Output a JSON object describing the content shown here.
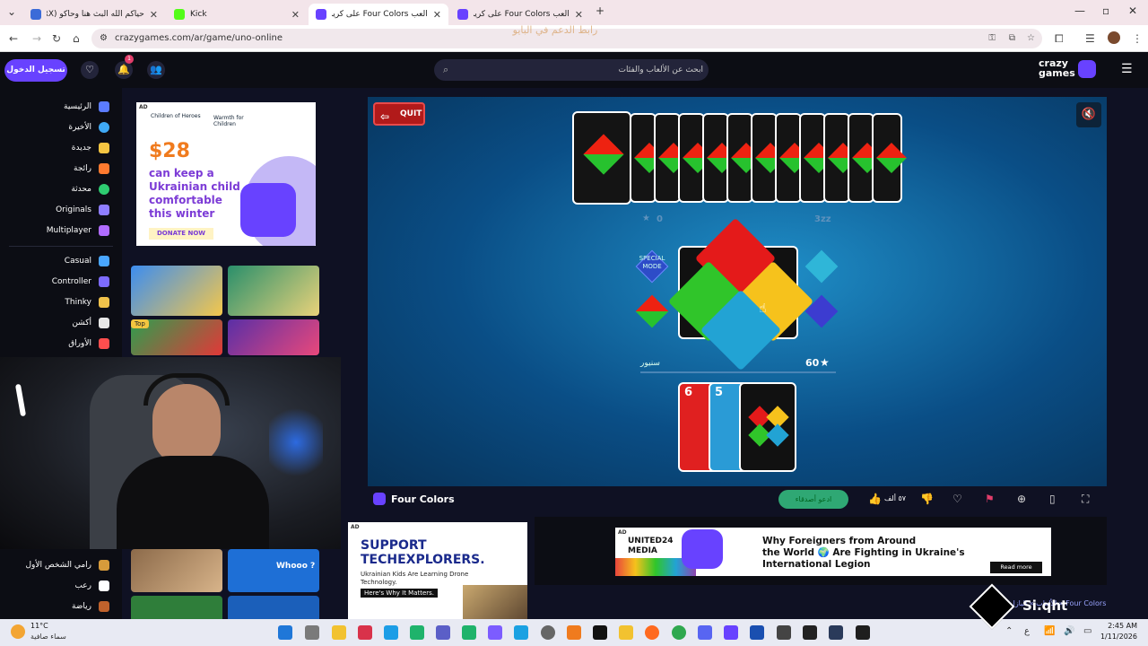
{
  "browser": {
    "tabs": [
      {
        "title": "حياكم الله البث هنا وحاكو (TWRX)",
        "fav": "#3b6bd8"
      },
      {
        "title": "Kick",
        "fav": "#53fc18"
      },
      {
        "title": "العب Four Colors على كريز...",
        "fav": "#6842ff"
      },
      {
        "title": "العب Four Colors على كريز...",
        "fav": "#6842ff"
      }
    ],
    "url": "crazygames.com/ar/game/uno-online",
    "watermark": "رابط الدعم في البايو"
  },
  "header": {
    "login_label": "تسجيل الدخول",
    "notif_count": "1",
    "search_placeholder": "ابحث عن الألعاب والفئات",
    "logo_line1": "crazy",
    "logo_line2": "games"
  },
  "sidebar": {
    "items": [
      {
        "label": "الرئيسية",
        "color": "#5b7cff"
      },
      {
        "label": "الأخيرة",
        "color": "#3fa9f5"
      },
      {
        "label": "جديدة",
        "color": "#f5c542"
      },
      {
        "label": "رائجة",
        "color": "#ff7a2f"
      },
      {
        "label": "محدثة",
        "color": "#2ecc71"
      },
      {
        "label": "Originals",
        "color": "#8e7dff"
      },
      {
        "label": "Multiplayer",
        "color": "#b06cff"
      },
      {
        "label": "Casual",
        "color": "#49a6ff"
      },
      {
        "label": "Controller",
        "color": "#7d6bff"
      },
      {
        "label": "Thinky",
        "color": "#f0c24b"
      },
      {
        "label": "أكشن",
        "color": "#e7e7e7"
      },
      {
        "label": "الأوراق",
        "color": "#ff4e4e"
      }
    ],
    "bottom_items": [
      {
        "label": "رامي الشخص الأول",
        "color": "#d79b3b"
      },
      {
        "label": "رعب",
        "color": "#ffffff"
      },
      {
        "label": "رياضة",
        "color": "#c0622c"
      }
    ]
  },
  "left_ad": {
    "tag": "AD",
    "org1": "Children of Heroes",
    "org2": "Warmth for Children",
    "amount": "$28",
    "line1": "can keep a",
    "line2": "Ukrainian child",
    "line3": "comfortable",
    "line4": "this winter",
    "cta": "DONATE NOW"
  },
  "thumbs": {
    "top_badge": "Top",
    "whooo": "Whooo ?"
  },
  "game": {
    "quit_label": "QUIT",
    "opponent_count_left": "0",
    "opponent_count_right": "3zz",
    "special_mode": "SPECIAL MODE",
    "player_name": "سنيور",
    "score": "60",
    "hand_numbers": [
      "6",
      "5"
    ]
  },
  "gamebar": {
    "title": "Four Colors",
    "invite_label": "ادعو أصدقاء",
    "likes": "٥٧ ألف"
  },
  "ads_bottom": {
    "tag": "AD",
    "support_l1": "SUPPORT",
    "support_l2": "TECHEXPLORERS.",
    "support_l3": "Ukrainian Kids Are Learning Drone",
    "support_l4": "Technology.",
    "support_l5": "Here's Why It Matters.",
    "wide_l1": "Why Foreigners from Around",
    "wide_l2": "the World 🌍 Are Fighting in Ukraine's",
    "wide_l3": "International Legion",
    "read_more": "Read more",
    "brand": "UNITED24 MEDIA"
  },
  "breadcrumb": "الألعاب » البازل » Four Colors",
  "stream_tag": "Si.qht",
  "taskbar": {
    "weather_temp": "11°C",
    "weather_desc": "سماء صافية",
    "time": "2:45 AM",
    "date": "1/11/2026",
    "lang": "ع"
  }
}
